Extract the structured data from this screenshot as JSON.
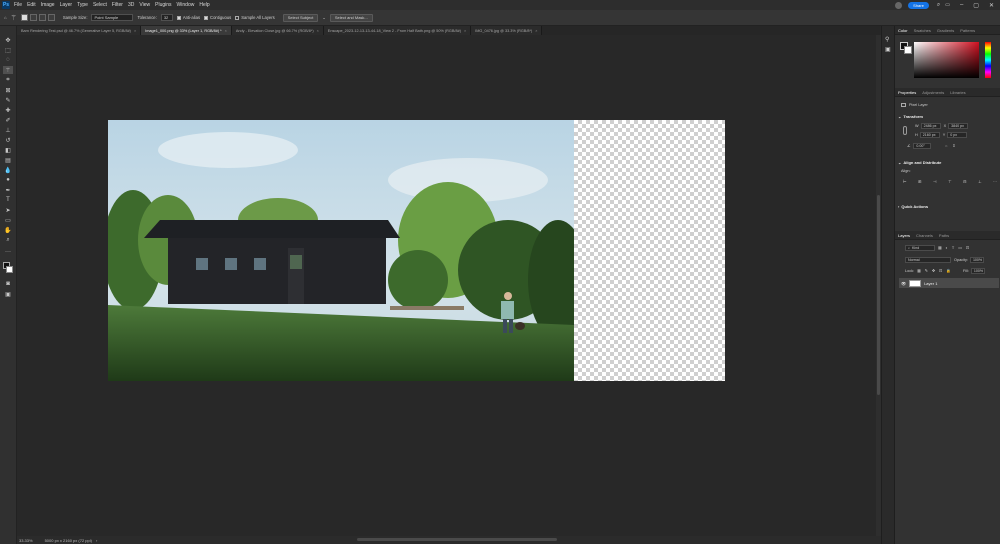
{
  "menubar": {
    "logo": "Ps",
    "items": [
      "File",
      "Edit",
      "Image",
      "Layer",
      "Type",
      "Select",
      "Filter",
      "3D",
      "View",
      "Plugins",
      "Window",
      "Help"
    ],
    "share_label": "Share"
  },
  "options": {
    "sample_size_label": "Sample Size:",
    "sample_size_value": "Point Sample",
    "tolerance_label": "Tolerance:",
    "tolerance_value": "32",
    "antialias_label": "Anti-alias",
    "contiguous_label": "Contiguous",
    "sample_all_layers_label": "Sample All Layers",
    "select_subject_label": "Select Subject",
    "select_and_mask_label": "Select and Mask..."
  },
  "tabs": [
    {
      "label": "Barn Rendering Test.psd @ 46.7% (Generative Layer 5, RGB/8#)",
      "active": false
    },
    {
      "label": "Image1_000.png @ 33% (Layer 1, RGB/8#) *",
      "active": true
    },
    {
      "label": "Andy - Elevation Close.jpg @ 66.7% (RGB/8*)",
      "active": false
    },
    {
      "label": "Enscape_2023-12-13-13-44-18_View 2 - From Half Bath.png @ 50% (RGB/8#)",
      "active": false
    },
    {
      "label": "IMG_0476.jpg @ 33.3% (RGB/8*)",
      "active": false
    }
  ],
  "status": {
    "zoom": "33.33%",
    "doc_info": "5000 px x 2160 px (72 ppi)"
  },
  "panels": {
    "color_tabs": [
      "Color",
      "Swatches",
      "Gradients",
      "Patterns"
    ],
    "properties_tabs": [
      "Properties",
      "Adjustments",
      "Libraries"
    ],
    "pixel_layer_label": "Pixel Layer",
    "transform_title": "Transform",
    "w_label": "W",
    "w_value": "2486 px",
    "h_label": "H",
    "h_value": "2160 px",
    "x_label": "X",
    "x_value": "3840 px",
    "y_label": "Y",
    "y_value": "0 px",
    "angle_value": "0.00°",
    "align_title": "Align and Distribute",
    "align_label": "Align:",
    "quick_actions_title": "Quick Actions",
    "layers_tabs": [
      "Layers",
      "Channels",
      "Paths"
    ],
    "kind_label": "Kind",
    "blend_mode": "Normal",
    "opacity_label": "Opacity:",
    "opacity_value": "100%",
    "lock_label": "Lock:",
    "fill_label": "Fill:",
    "fill_value": "100%",
    "layer_name": "Layer 1"
  },
  "colors": {
    "accent": "#1473e6",
    "fg_swatch": "#111111",
    "bg_swatch": "#ffffff",
    "picker_hue": "#d01020"
  }
}
